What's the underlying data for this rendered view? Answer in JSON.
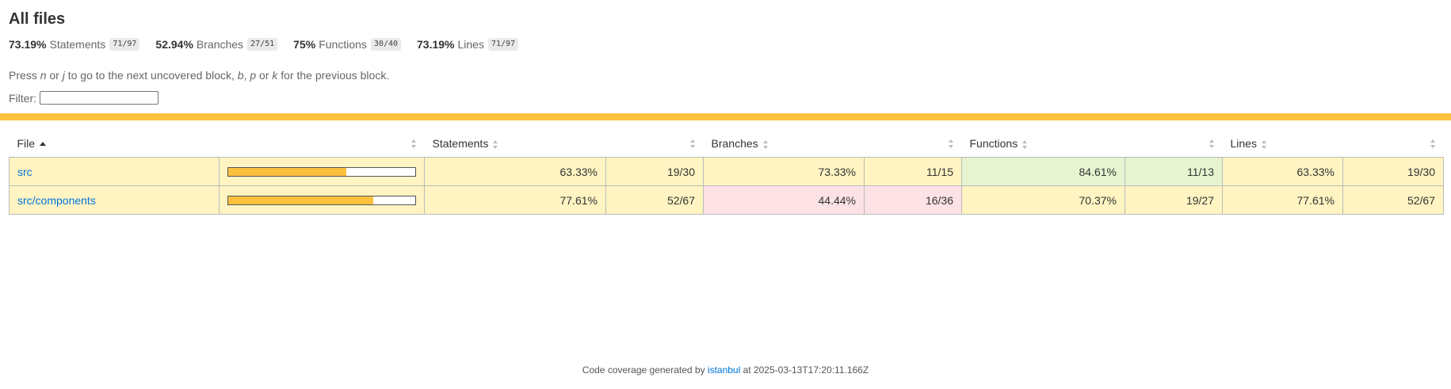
{
  "title": "All files",
  "summary": [
    {
      "pct": "73.19%",
      "label": "Statements",
      "fraction": "71/97"
    },
    {
      "pct": "52.94%",
      "label": "Branches",
      "fraction": "27/51"
    },
    {
      "pct": "75%",
      "label": "Functions",
      "fraction": "30/40"
    },
    {
      "pct": "73.19%",
      "label": "Lines",
      "fraction": "71/97"
    }
  ],
  "hint": {
    "t1": "Press ",
    "k1": "n",
    "t2": " or ",
    "k2": "j",
    "t3": " to go to the next uncovered block, ",
    "k3": "b",
    "t4": ", ",
    "k4": "p",
    "t5": " or ",
    "k5": "k",
    "t6": " for the previous block."
  },
  "filter": {
    "label": "Filter:",
    "value": ""
  },
  "colors": {
    "accent": "#fbc13d",
    "medium": "#fff4c2",
    "low": "#fce1e5",
    "high": "#e6f5d0",
    "link": "#0074d9"
  },
  "table": {
    "headers": {
      "file": "File",
      "statements": "Statements",
      "branches": "Branches",
      "functions": "Functions",
      "lines": "Lines"
    },
    "rows": [
      {
        "file": "src",
        "coverage_fraction": 0.6333,
        "statements_pct": "63.33%",
        "statements_frac": "19/30",
        "branches_pct": "73.33%",
        "branches_frac": "11/15",
        "functions_pct": "84.61%",
        "functions_frac": "11/13",
        "lines_pct": "63.33%",
        "lines_frac": "19/30"
      },
      {
        "file": "src/components",
        "coverage_fraction": 0.7761,
        "statements_pct": "77.61%",
        "statements_frac": "52/67",
        "branches_pct": "44.44%",
        "branches_frac": "16/36",
        "functions_pct": "70.37%",
        "functions_frac": "19/27",
        "lines_pct": "77.61%",
        "lines_frac": "52/67"
      }
    ]
  },
  "footer": {
    "prefix": "Code coverage generated by ",
    "link": "istanbul",
    "suffix": " at 2025-03-13T17:20:11.166Z"
  }
}
